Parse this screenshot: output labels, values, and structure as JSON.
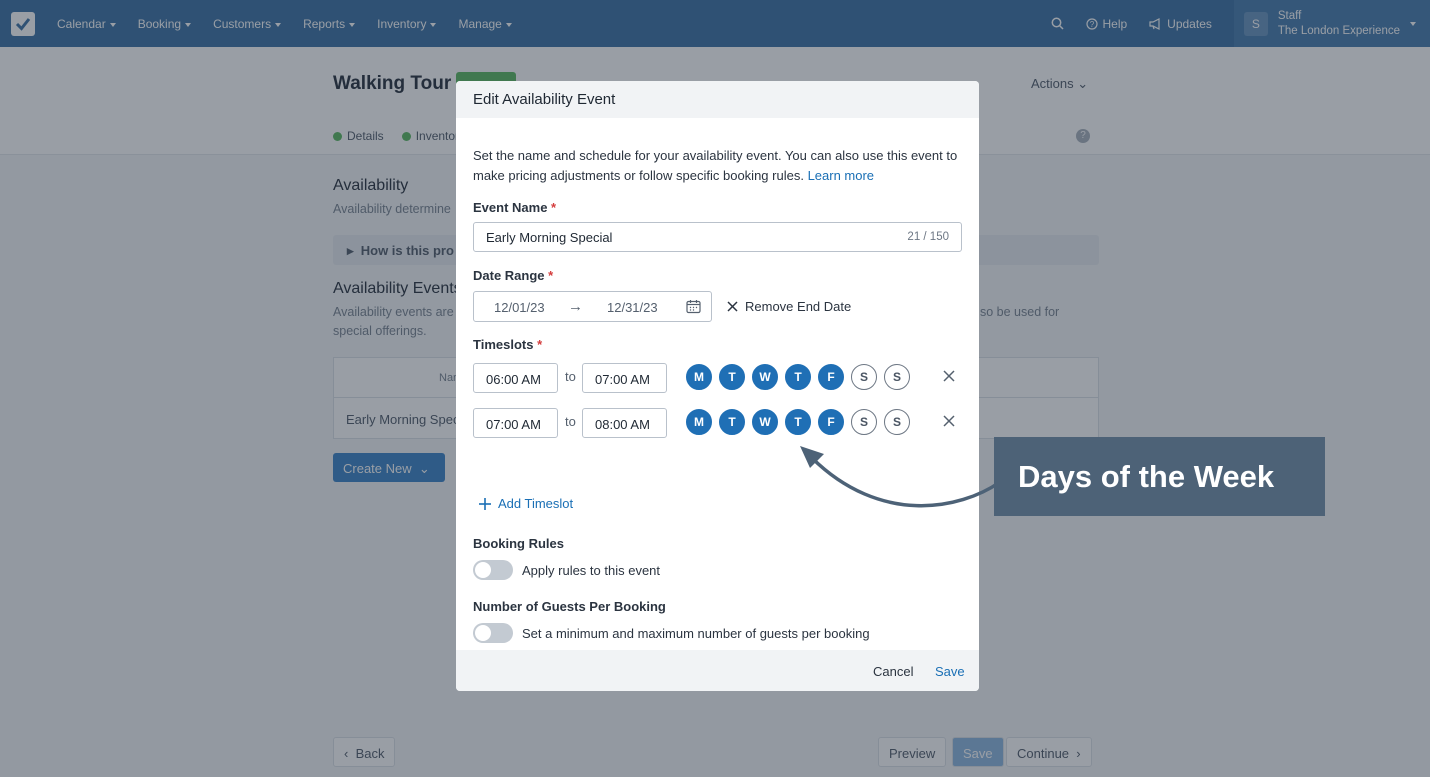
{
  "nav": {
    "items": [
      "Calendar",
      "Booking",
      "Customers",
      "Reports",
      "Inventory",
      "Manage"
    ],
    "help": "Help",
    "updates": "Updates",
    "avatar_letter": "S",
    "user_role": "Staff",
    "company": "The London Experience",
    "brand_color": "#3e74a6"
  },
  "page": {
    "title": "Walking Tour",
    "actions": "Actions",
    "steps": [
      "Details",
      "Inventory"
    ],
    "availability_heading": "Availability",
    "availability_sub": "Availability determine",
    "faq_prompt": "How is this pro",
    "events_heading": "Availability Events",
    "events_sub_1": "Availability events are",
    "events_sub_tail": "so be used for",
    "events_sub_2": "special offerings.",
    "table_header": "Nar",
    "table_row": "Early Morning Spec",
    "create_new": "Create New",
    "back": "Back",
    "preview": "Preview",
    "save": "Save",
    "continue": "Continue"
  },
  "modal": {
    "title": "Edit Availability Event",
    "intro": "Set the name and schedule for your availability event. You can also use this event to make pricing adjustments or follow specific booking rules.",
    "learn_more": "Learn more",
    "event_name_label": "Event Name",
    "event_name_value": "Early Morning Special",
    "event_name_count": "21 / 150",
    "date_range_label": "Date Range",
    "date_start": "12/01/23",
    "date_end": "12/31/23",
    "remove_end_date": "Remove End Date",
    "timeslots_label": "Timeslots",
    "to_label": "to",
    "timeslots": [
      {
        "start": "06:00 AM",
        "end": "07:00 AM"
      },
      {
        "start": "07:00 AM",
        "end": "08:00 AM"
      }
    ],
    "day_letters": [
      "M",
      "T",
      "W",
      "T",
      "F",
      "S",
      "S"
    ],
    "days_enabled": [
      true,
      true,
      true,
      true,
      true,
      false,
      false
    ],
    "add_timeslot": "Add Timeslot",
    "booking_rules_label": "Booking Rules",
    "booking_rules_toggle": "Apply rules to this event",
    "guests_label": "Number of Guests Per Booking",
    "guests_toggle": "Set a minimum and maximum number of guests per booking",
    "cancel": "Cancel",
    "save": "Save",
    "accent_color": "#1f6fb5"
  },
  "annotation": {
    "callout": "Days of the Week",
    "color": "#4d6277"
  }
}
